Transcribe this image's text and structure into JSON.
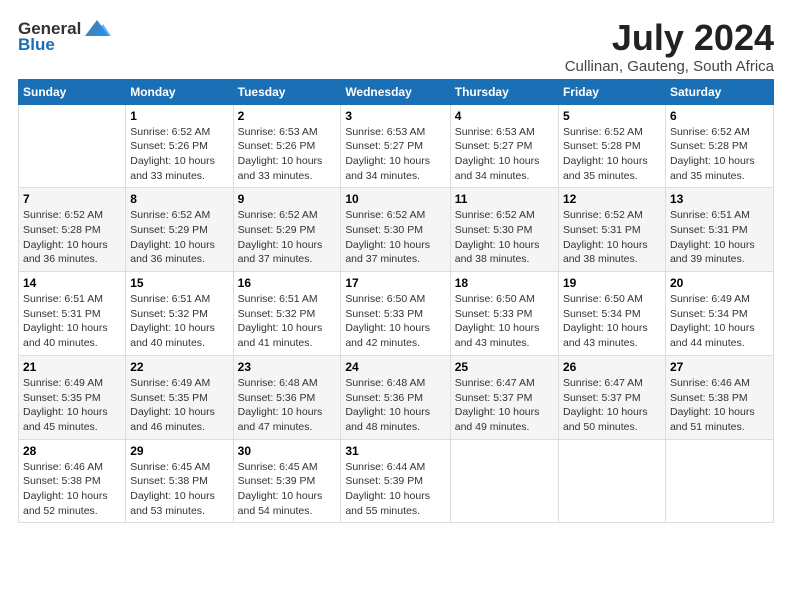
{
  "header": {
    "logo_general": "General",
    "logo_blue": "Blue",
    "month_title": "July 2024",
    "location": "Cullinan, Gauteng, South Africa"
  },
  "days_of_week": [
    "Sunday",
    "Monday",
    "Tuesday",
    "Wednesday",
    "Thursday",
    "Friday",
    "Saturday"
  ],
  "weeks": [
    [
      {
        "day": "",
        "info": ""
      },
      {
        "day": "1",
        "info": "Sunrise: 6:52 AM\nSunset: 5:26 PM\nDaylight: 10 hours\nand 33 minutes."
      },
      {
        "day": "2",
        "info": "Sunrise: 6:53 AM\nSunset: 5:26 PM\nDaylight: 10 hours\nand 33 minutes."
      },
      {
        "day": "3",
        "info": "Sunrise: 6:53 AM\nSunset: 5:27 PM\nDaylight: 10 hours\nand 34 minutes."
      },
      {
        "day": "4",
        "info": "Sunrise: 6:53 AM\nSunset: 5:27 PM\nDaylight: 10 hours\nand 34 minutes."
      },
      {
        "day": "5",
        "info": "Sunrise: 6:52 AM\nSunset: 5:28 PM\nDaylight: 10 hours\nand 35 minutes."
      },
      {
        "day": "6",
        "info": "Sunrise: 6:52 AM\nSunset: 5:28 PM\nDaylight: 10 hours\nand 35 minutes."
      }
    ],
    [
      {
        "day": "7",
        "info": "Sunrise: 6:52 AM\nSunset: 5:28 PM\nDaylight: 10 hours\nand 36 minutes."
      },
      {
        "day": "8",
        "info": "Sunrise: 6:52 AM\nSunset: 5:29 PM\nDaylight: 10 hours\nand 36 minutes."
      },
      {
        "day": "9",
        "info": "Sunrise: 6:52 AM\nSunset: 5:29 PM\nDaylight: 10 hours\nand 37 minutes."
      },
      {
        "day": "10",
        "info": "Sunrise: 6:52 AM\nSunset: 5:30 PM\nDaylight: 10 hours\nand 37 minutes."
      },
      {
        "day": "11",
        "info": "Sunrise: 6:52 AM\nSunset: 5:30 PM\nDaylight: 10 hours\nand 38 minutes."
      },
      {
        "day": "12",
        "info": "Sunrise: 6:52 AM\nSunset: 5:31 PM\nDaylight: 10 hours\nand 38 minutes."
      },
      {
        "day": "13",
        "info": "Sunrise: 6:51 AM\nSunset: 5:31 PM\nDaylight: 10 hours\nand 39 minutes."
      }
    ],
    [
      {
        "day": "14",
        "info": "Sunrise: 6:51 AM\nSunset: 5:31 PM\nDaylight: 10 hours\nand 40 minutes."
      },
      {
        "day": "15",
        "info": "Sunrise: 6:51 AM\nSunset: 5:32 PM\nDaylight: 10 hours\nand 40 minutes."
      },
      {
        "day": "16",
        "info": "Sunrise: 6:51 AM\nSunset: 5:32 PM\nDaylight: 10 hours\nand 41 minutes."
      },
      {
        "day": "17",
        "info": "Sunrise: 6:50 AM\nSunset: 5:33 PM\nDaylight: 10 hours\nand 42 minutes."
      },
      {
        "day": "18",
        "info": "Sunrise: 6:50 AM\nSunset: 5:33 PM\nDaylight: 10 hours\nand 43 minutes."
      },
      {
        "day": "19",
        "info": "Sunrise: 6:50 AM\nSunset: 5:34 PM\nDaylight: 10 hours\nand 43 minutes."
      },
      {
        "day": "20",
        "info": "Sunrise: 6:49 AM\nSunset: 5:34 PM\nDaylight: 10 hours\nand 44 minutes."
      }
    ],
    [
      {
        "day": "21",
        "info": "Sunrise: 6:49 AM\nSunset: 5:35 PM\nDaylight: 10 hours\nand 45 minutes."
      },
      {
        "day": "22",
        "info": "Sunrise: 6:49 AM\nSunset: 5:35 PM\nDaylight: 10 hours\nand 46 minutes."
      },
      {
        "day": "23",
        "info": "Sunrise: 6:48 AM\nSunset: 5:36 PM\nDaylight: 10 hours\nand 47 minutes."
      },
      {
        "day": "24",
        "info": "Sunrise: 6:48 AM\nSunset: 5:36 PM\nDaylight: 10 hours\nand 48 minutes."
      },
      {
        "day": "25",
        "info": "Sunrise: 6:47 AM\nSunset: 5:37 PM\nDaylight: 10 hours\nand 49 minutes."
      },
      {
        "day": "26",
        "info": "Sunrise: 6:47 AM\nSunset: 5:37 PM\nDaylight: 10 hours\nand 50 minutes."
      },
      {
        "day": "27",
        "info": "Sunrise: 6:46 AM\nSunset: 5:38 PM\nDaylight: 10 hours\nand 51 minutes."
      }
    ],
    [
      {
        "day": "28",
        "info": "Sunrise: 6:46 AM\nSunset: 5:38 PM\nDaylight: 10 hours\nand 52 minutes."
      },
      {
        "day": "29",
        "info": "Sunrise: 6:45 AM\nSunset: 5:38 PM\nDaylight: 10 hours\nand 53 minutes."
      },
      {
        "day": "30",
        "info": "Sunrise: 6:45 AM\nSunset: 5:39 PM\nDaylight: 10 hours\nand 54 minutes."
      },
      {
        "day": "31",
        "info": "Sunrise: 6:44 AM\nSunset: 5:39 PM\nDaylight: 10 hours\nand 55 minutes."
      },
      {
        "day": "",
        "info": ""
      },
      {
        "day": "",
        "info": ""
      },
      {
        "day": "",
        "info": ""
      }
    ]
  ]
}
